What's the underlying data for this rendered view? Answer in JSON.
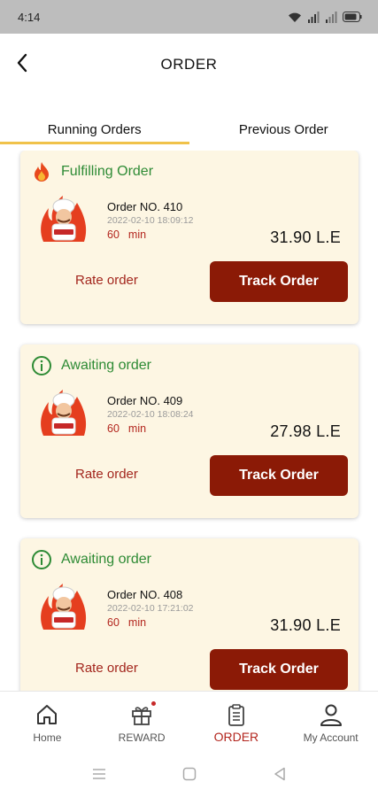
{
  "status_bar": {
    "time": "4:14"
  },
  "header": {
    "title": "ORDER"
  },
  "tabs": [
    {
      "label": "Running Orders",
      "active": true
    },
    {
      "label": "Previous Order",
      "active": false
    }
  ],
  "orders": [
    {
      "status": "Fulfilling Order",
      "status_icon": "fire-icon",
      "order_no": "Order NO. 410",
      "date": "2022-02-10 18:09:12",
      "time_value": "60",
      "time_unit": "min",
      "price": "31.90 L.E",
      "rate_label": "Rate order",
      "track_label": "Track Order"
    },
    {
      "status": "Awaiting order",
      "status_icon": "info-icon",
      "order_no": "Order NO. 409",
      "date": "2022-02-10 18:08:24",
      "time_value": "60",
      "time_unit": "min",
      "price": "27.98 L.E",
      "rate_label": "Rate order",
      "track_label": "Track Order"
    },
    {
      "status": "Awaiting order",
      "status_icon": "info-icon",
      "order_no": "Order NO. 408",
      "date": "2022-02-10 17:21:02",
      "time_value": "60",
      "time_unit": "min",
      "price": "31.90 L.E",
      "rate_label": "Rate order",
      "track_label": "Track Order"
    }
  ],
  "bottom_nav": [
    {
      "label": "Home",
      "icon": "home-icon"
    },
    {
      "label": "REWARD",
      "icon": "gift-icon"
    },
    {
      "label": "ORDER",
      "icon": "clipboard-icon",
      "active": true
    },
    {
      "label": "My Account",
      "icon": "user-icon"
    }
  ],
  "colors": {
    "accent": "#8b1a06",
    "status_green": "#2e8b35",
    "card_bg": "#fdf6e3",
    "tab_underline": "#f0c24a",
    "time_red": "#b3261e"
  }
}
